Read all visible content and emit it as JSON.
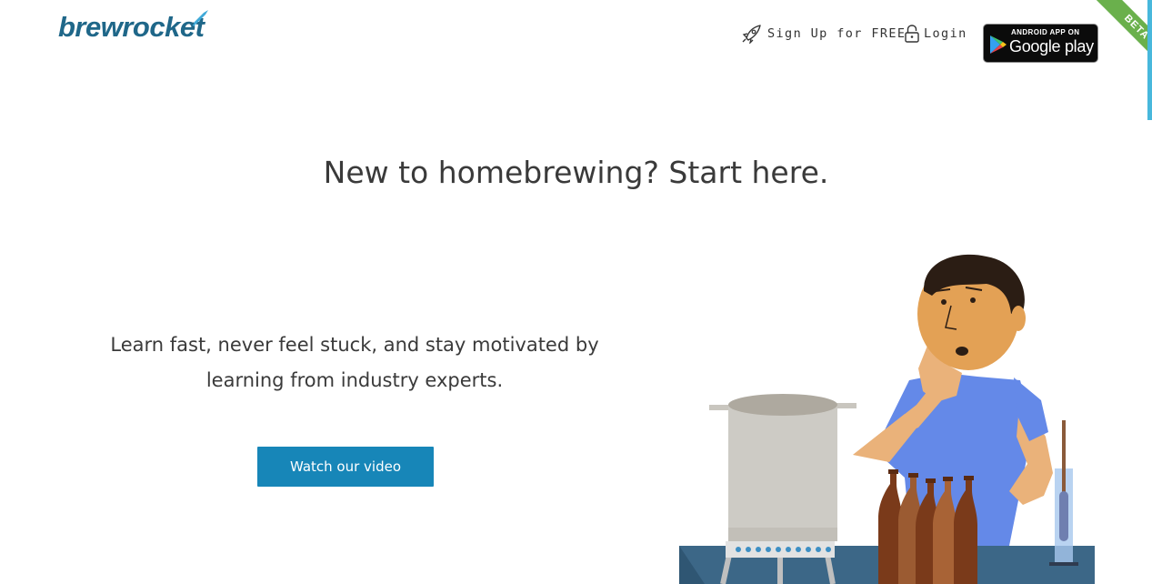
{
  "header": {
    "logo_text": "brewrocket",
    "signup_label": "Sign Up for FREE",
    "login_label": "Login",
    "play_badge": {
      "small_text": "ANDROID APP ON",
      "big_text": "Google play"
    },
    "beta_label": "BETA"
  },
  "hero": {
    "title": "New to homebrewing? Start here.",
    "subtitle_line1": "Learn fast, never feel stuck, and stay motivated by",
    "subtitle_line2": "learning from industry experts.",
    "cta_label": "Watch our video"
  },
  "colors": {
    "brand": "#1f6789",
    "button": "#1786b8",
    "beta_ribbon": "#6ab04c"
  },
  "icons": [
    "rocket-icon",
    "lock-icon",
    "google-play-icon"
  ]
}
